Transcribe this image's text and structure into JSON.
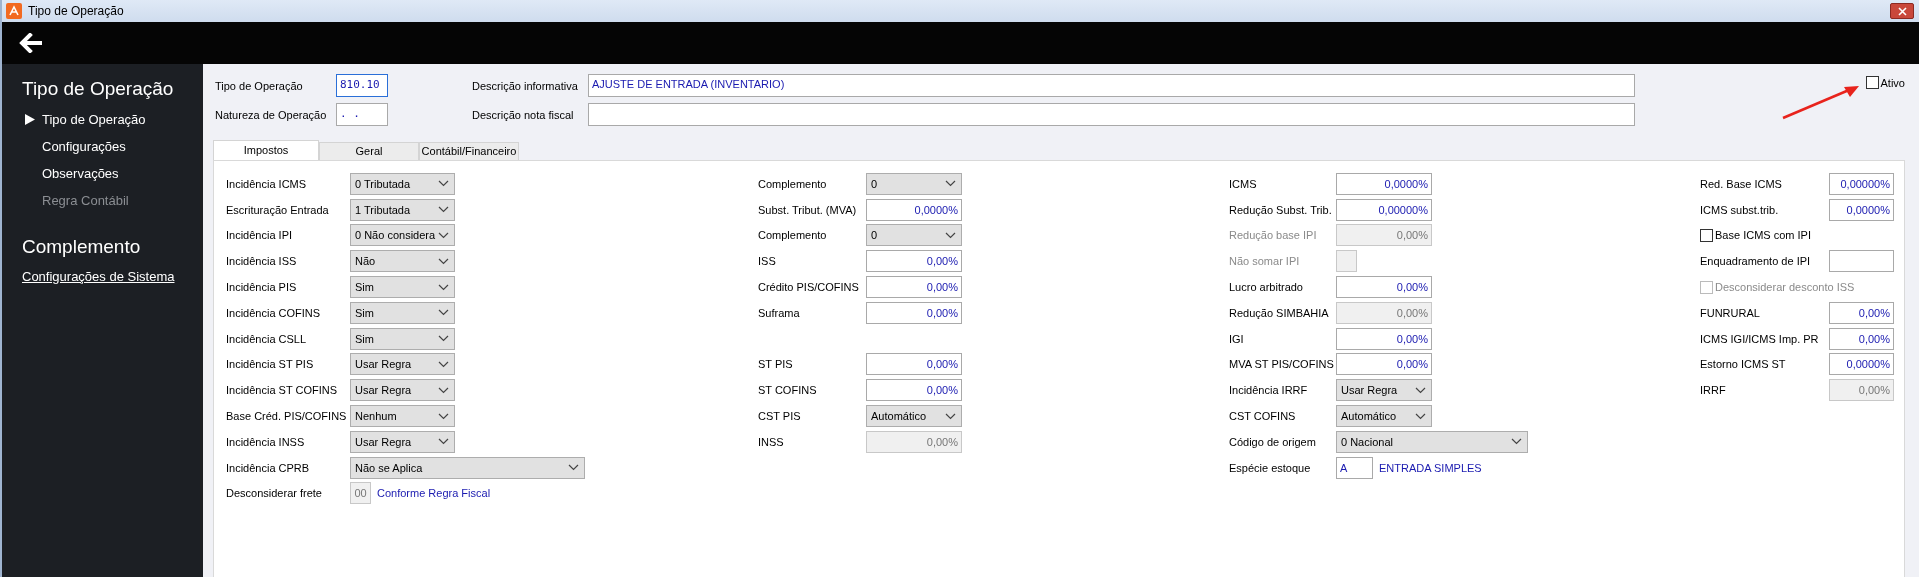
{
  "window": {
    "title": "Tipo de Operação"
  },
  "sidebar": {
    "sections": [
      {
        "heading": "Tipo de Operação",
        "items": [
          {
            "label": "Tipo de Operação",
            "selected": true,
            "disabled": false
          },
          {
            "label": "Configurações",
            "selected": false,
            "disabled": false
          },
          {
            "label": "Observações",
            "selected": false,
            "disabled": false
          },
          {
            "label": "Regra Contábil",
            "selected": false,
            "disabled": true
          }
        ]
      },
      {
        "heading": "Complemento",
        "links": [
          "Configurações de Sistema"
        ]
      }
    ]
  },
  "header": {
    "rows": [
      [
        {
          "label": "Tipo de Operação",
          "value": "810.10",
          "focused": true,
          "kind": "short"
        },
        {
          "label": "Descrição informativa",
          "value": "AJUSTE DE ENTRADA (INVENTARIO)",
          "focused": false,
          "kind": "long"
        }
      ],
      [
        {
          "label": "Natureza de Operação",
          "value": ". .",
          "focused": false,
          "kind": "short"
        },
        {
          "label": "Descrição nota fiscal",
          "focused": false,
          "kind": "long"
        }
      ]
    ],
    "active": {
      "label": "Ativo",
      "checked": false
    }
  },
  "tabs": [
    {
      "label": "Impostos",
      "selected": true
    },
    {
      "label": "Geral",
      "selected": false
    },
    {
      "label": "Contábil/Financeiro",
      "selected": false
    }
  ],
  "form": {
    "rows": [
      [
        {
          "kind": "select",
          "label": "Incidência ICMS",
          "value": "0 Tributada",
          "disabled": false,
          "label_dimmed": false
        },
        {
          "kind": "select",
          "label": "Complemento",
          "value": "0",
          "disabled": false,
          "label_dimmed": false
        },
        {
          "kind": "input",
          "label": "ICMS",
          "value": "0,0000%",
          "disabled": false,
          "label_dimmed": false
        },
        {
          "kind": "input",
          "label": "Red. Base ICMS",
          "value": "0,00000%",
          "disabled": false,
          "label_dimmed": false
        }
      ],
      [
        {
          "kind": "select",
          "label": "Escrituração Entrada",
          "value": "1 Tributada",
          "disabled": false,
          "label_dimmed": false
        },
        {
          "kind": "input",
          "label": "Subst. Tribut. (MVA)",
          "value": "0,0000%",
          "disabled": false,
          "label_dimmed": false
        },
        {
          "kind": "input",
          "label": "Redução Subst. Trib.",
          "value": "0,00000%",
          "disabled": false,
          "label_dimmed": false
        },
        {
          "kind": "input",
          "label": "ICMS subst.trib.",
          "value": "0,0000%",
          "disabled": false,
          "label_dimmed": false
        }
      ],
      [
        {
          "kind": "select",
          "label": "Incidência IPI",
          "value": "0 Não considera",
          "disabled": false,
          "label_dimmed": false
        },
        {
          "kind": "select",
          "label": "Complemento",
          "value": "0",
          "disabled": false,
          "label_dimmed": false
        },
        {
          "kind": "input",
          "label": "Redução base IPI",
          "value": "0,00%",
          "disabled": true,
          "label_dimmed": true
        },
        {
          "kind": "checkbox",
          "label": "Base ICMS com IPI",
          "checked": false,
          "disabled": false,
          "label_dimmed": false
        }
      ],
      [
        {
          "kind": "select",
          "label": "Incidência ISS",
          "value": "Não",
          "disabled": false,
          "label_dimmed": false
        },
        {
          "kind": "input",
          "label": "ISS",
          "value": "0,00%",
          "disabled": false,
          "label_dimmed": false
        },
        {
          "kind": "box",
          "label": "Não somar IPI",
          "disabled": true,
          "label_dimmed": true
        },
        {
          "kind": "input",
          "label": "Enquadramento de IPI",
          "disabled": false,
          "label_dimmed": false
        }
      ],
      [
        {
          "kind": "select",
          "label": "Incidência PIS",
          "value": "Sim",
          "disabled": false,
          "label_dimmed": false
        },
        {
          "kind": "input",
          "label": "Crédito PIS/COFINS",
          "value": "0,00%",
          "disabled": false,
          "label_dimmed": false
        },
        {
          "kind": "input",
          "label": "Lucro arbitrado",
          "value": "0,00%",
          "disabled": false,
          "label_dimmed": false
        },
        {
          "kind": "checkbox",
          "label": "Desconsiderar desconto ISS",
          "checked": false,
          "disabled": true,
          "label_dimmed": true
        }
      ],
      [
        {
          "kind": "select",
          "label": "Incidência COFINS",
          "value": "Sim",
          "disabled": false,
          "label_dimmed": false
        },
        {
          "kind": "input",
          "label": "Suframa",
          "value": "0,00%",
          "disabled": false,
          "label_dimmed": false
        },
        {
          "kind": "input",
          "label": "Redução SIMBAHIA",
          "value": "0,00%",
          "disabled": true,
          "label_dimmed": false
        },
        {
          "kind": "input",
          "label": "FUNRURAL",
          "value": "0,00%",
          "disabled": false,
          "label_dimmed": false
        }
      ],
      [
        {
          "kind": "select",
          "label": "Incidência CSLL",
          "value": "Sim",
          "disabled": false,
          "label_dimmed": false
        },
        null,
        {
          "kind": "input",
          "label": "IGI",
          "value": "0,00%",
          "disabled": false,
          "label_dimmed": false
        },
        {
          "kind": "input",
          "label": "ICMS IGI/ICMS Imp. PR",
          "value": "0,00%",
          "disabled": false,
          "label_dimmed": false
        }
      ],
      [
        {
          "kind": "select",
          "label": "Incidência ST PIS",
          "value": "Usar Regra",
          "disabled": false,
          "label_dimmed": false
        },
        {
          "kind": "input",
          "label": "ST PIS",
          "value": "0,00%",
          "disabled": false,
          "label_dimmed": false
        },
        {
          "kind": "input",
          "label": "MVA ST PIS/COFINS",
          "value": "0,00%",
          "disabled": false,
          "label_dimmed": false
        },
        {
          "kind": "input",
          "label": "Estorno ICMS ST",
          "value": "0,0000%",
          "disabled": false,
          "label_dimmed": false
        }
      ],
      [
        {
          "kind": "select",
          "label": "Incidência ST COFINS",
          "value": "Usar Regra",
          "disabled": false,
          "label_dimmed": false
        },
        {
          "kind": "input",
          "label": "ST COFINS",
          "value": "0,00%",
          "disabled": false,
          "label_dimmed": false
        },
        {
          "kind": "select",
          "label": "Incidência IRRF",
          "value": "Usar Regra",
          "disabled": false,
          "label_dimmed": false
        },
        {
          "kind": "input",
          "label": "IRRF",
          "value": "0,00%",
          "disabled": true,
          "label_dimmed": false
        }
      ],
      [
        {
          "kind": "select",
          "label": "Base Créd. PIS/COFINS",
          "value": "Nenhum",
          "disabled": false,
          "label_dimmed": false
        },
        {
          "kind": "select",
          "label": "CST PIS",
          "value": "Automático",
          "disabled": false,
          "label_dimmed": false
        },
        {
          "kind": "select",
          "label": "CST COFINS",
          "value": "Automático",
          "disabled": false,
          "label_dimmed": false
        },
        null
      ],
      [
        {
          "kind": "select",
          "label": "Incidência INSS",
          "value": "Usar Regra",
          "disabled": false,
          "label_dimmed": false
        },
        {
          "kind": "input",
          "label": "INSS",
          "value": "0,00%",
          "disabled": true,
          "label_dimmed": false
        },
        {
          "kind": "select-wide",
          "label": "Código de origem",
          "value": "0 Nacional",
          "disabled": false,
          "label_dimmed": false
        },
        null
      ],
      [
        {
          "kind": "select-wide",
          "label": "Incidência CPRB",
          "value": "Não se Aplica",
          "disabled": false,
          "label_dimmed": false
        },
        null,
        {
          "kind": "code",
          "label": "Espécie estoque",
          "value": "A",
          "note": "ENTRADA SIMPLES",
          "disabled": false,
          "label_dimmed": false
        },
        null
      ],
      [
        {
          "kind": "code-small",
          "label": "Desconsiderar frete",
          "value": "00",
          "note": "Conforme Regra Fiscal",
          "disabled": true,
          "label_dimmed": false
        },
        null,
        null,
        null
      ]
    ]
  }
}
